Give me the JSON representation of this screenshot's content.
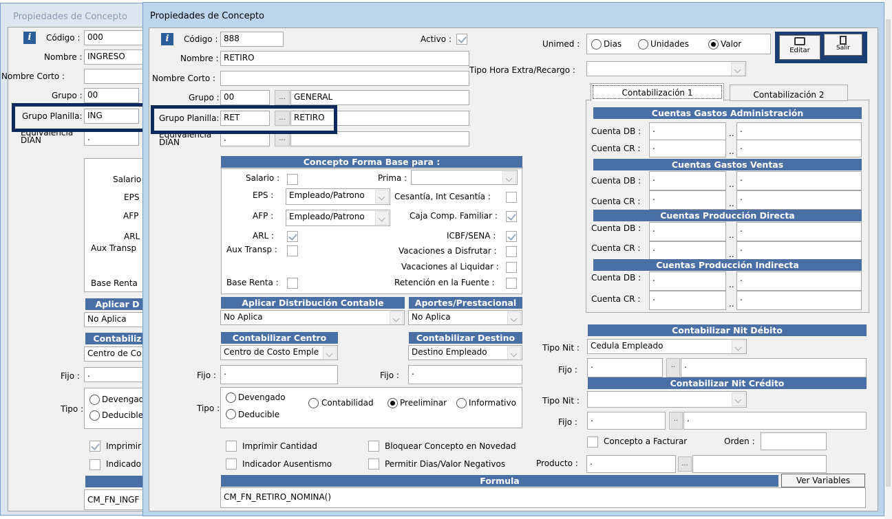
{
  "back": {
    "title": "Propiedades de Concepto",
    "codigo_label": "Código :",
    "codigo": "000",
    "nombre_label": "Nombre :",
    "nombre": "INGRESO",
    "corto_label": "Nombre Corto :",
    "grupo_label": "Grupo :",
    "grupo": "00",
    "gp_label": "Grupo Planilla:",
    "gp": "ING",
    "eq_label": "Equivalencia DIAN",
    "eq": ".",
    "salario": "Salario",
    "eps": "EPS",
    "afp": "AFP",
    "arl": "ARL",
    "aux": "Aux Transp",
    "renta": "Base Renta",
    "aplicar_hdr": "Aplicar D",
    "aplicar": "No Aplica",
    "contab_hdr": "Contabiliz",
    "centro": "Centro de Co",
    "fijo_label": "Fijo :",
    "fijo": ".",
    "tipo_label": "Tipo :",
    "tipo_dev": "Devengad",
    "tipo_ded": "Deducible",
    "imprimir": "Imprimir",
    "indicador": "Indicado",
    "formula": "CM_FN_INGF"
  },
  "front": {
    "title": "Propiedades de Concepto",
    "codigo_label": "Código :",
    "codigo": "888",
    "activo_label": "Activo :",
    "nombre_label": "Nombre :",
    "nombre": "RETIRO",
    "corto_label": "Nombre Corto :",
    "grupo_label": "Grupo :",
    "grupo": "00",
    "grupo_desc": "GENERAL",
    "gp_label": "Grupo Planilla:",
    "gp": "RET",
    "gp_desc": "RETIRO",
    "eq_label": "Equivalencia DIAN",
    "eq": ".",
    "ell": "...",
    "base_hdr": "Concepto Forma Base para :",
    "salario": "Salario :",
    "prima": "Prima :",
    "eps": "EPS :",
    "eps_val": "Empleado/Patrono",
    "cesantia": "Cesantía, Int Cesantía :",
    "afp": "AFP :",
    "afp_val": "Empleado/Patrono",
    "caja": "Caja Comp. Familiar :",
    "arl": "ARL :",
    "icbf": "ICBF/SENA :",
    "aux": "Aux Transp :",
    "vac_disf": "Vacaciones a Disfrutar :",
    "vac_liq": "Vacaciones al Liquidar :",
    "renta": "Base Renta :",
    "retencion": "Retención en la Fuente :",
    "aplicar_hdr": "Aplicar Distribución Contable",
    "aplicar": "No Aplica",
    "aportes_hdr": "Aportes/Prestacional",
    "aportes": "No Aplica",
    "centro_hdr": "Contabilizar Centro",
    "centro": "Centro de Costo Emple",
    "destino_hdr": "Contabilizar Destino",
    "destino": "Destino Empleado",
    "fijo_label": "Fijo :",
    "fijo": ".",
    "fijo2": ".",
    "tipo_label": "Tipo :",
    "tipo_dev": "Devengado",
    "tipo_ded": "Deducible",
    "tipo_cont": "Contabilidad",
    "tipo_pre": "Preeliminar",
    "tipo_inf": "Informativo",
    "imp_cant": "Imprimir Cantidad",
    "bloquear": "Bloquear Concepto en Novedad",
    "ind_aus": "Indicador Ausentismo",
    "permitir": "Permitir Dias/Valor Negativos",
    "formula_hdr": "Formula",
    "ver_var": "Ver Variables",
    "formula": "CM_FN_RETIRO_NOMINA()",
    "unimed_label": "Unimed :",
    "dias": "Dias",
    "unidades": "Unidades",
    "valor": "Valor",
    "editar": "Editar",
    "salir": "Salir",
    "tipo_hora_label": "Tipo Hora Extra/Recargo :",
    "tab1": "Contabilización 1",
    "tab2": "Contabilización 2",
    "cga_hdr": "Cuentas Gastos Administración",
    "cgv_hdr": "Cuentas Gastos Ventas",
    "cpd_hdr": "Cuentas Producción Directa",
    "cpi_hdr": "Cuentas Producción Indirecta",
    "cdb": "Cuenta DB :",
    "ccr": "Cuenta CR :",
    "dot": ".",
    "dd": "..",
    "nitdeb_hdr": "Contabilizar Nit Débito",
    "tiponit_label": "Tipo Nit :",
    "tiponit": "Cedula Empleado",
    "nitcred_hdr": "Contabilizar Nit Crédito",
    "facturar": "Concepto a Facturar",
    "orden_label": "Orden :",
    "producto_label": "Producto :",
    "producto": "."
  },
  "colors": {
    "header": "#4a6fa5",
    "title_bar": "#bcd4ec",
    "highlight": "#0d2a5c"
  }
}
